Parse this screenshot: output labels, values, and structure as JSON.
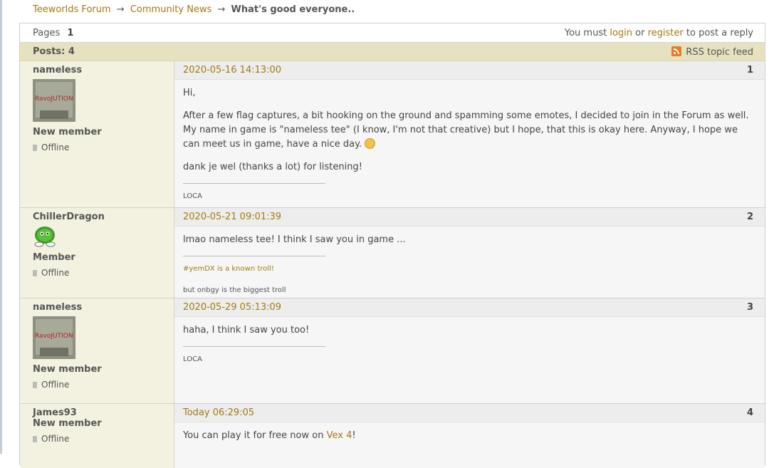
{
  "breadcrumb": {
    "forum": "Teeworlds Forum",
    "section": "Community News",
    "topic": "What's good everyone..",
    "separator": "→"
  },
  "pagination": {
    "label": "Pages",
    "current": "1"
  },
  "login_prompt": {
    "prefix": "You must",
    "login": "login",
    "or": "or",
    "register": "register",
    "suffix": "to post a reply"
  },
  "posts_bar": {
    "count_label": "Posts: 4",
    "rss_label": "RSS topic feed"
  },
  "colors": {
    "link": "#a07a10",
    "author_bg": "#f3f2e0",
    "posts_bar_bg": "#e6e2c0",
    "rss": "#e87b24"
  },
  "posts": [
    {
      "number": "1",
      "date": "2020-05-16 14:13:00",
      "author": "nameless",
      "avatar": "avatar-ravolution",
      "avatar_text": "RavoJUTION",
      "rank": "New member",
      "status": "Offline",
      "paragraphs": [
        "Hi,",
        "After a few flag captures, a bit hooking on the ground and spamming some emotes, I decided to join in the Forum as well. My name in game is \"nameless tee\" (I know, I'm not that creative) but I hope, that this is okay here. Anyway, I hope we can meet us in game, have a nice day.",
        "dank je wel (thanks a lot) for listening!"
      ],
      "signature": [
        "LOCA"
      ]
    },
    {
      "number": "2",
      "date": "2020-05-21 09:01:39",
      "author": "ChillerDragon",
      "avatar": "avatar-green-tee",
      "rank": "Member",
      "status": "Offline",
      "paragraphs": [
        "lmao nameless tee! I think I saw you in game ..."
      ],
      "signature": [
        "#yemDX is a known troll!",
        "but onbgy is the biggest troll"
      ]
    },
    {
      "number": "3",
      "date": "2020-05-29 05:13:09",
      "author": "nameless",
      "avatar": "avatar-ravolution",
      "avatar_text": "RavoJUTION",
      "rank": "New member",
      "status": "Offline",
      "paragraphs": [
        "haha, I think I saw you too!"
      ],
      "signature": [
        "LOCA"
      ]
    },
    {
      "number": "4",
      "date": "Today 06:29:05",
      "author": "James93",
      "rank": "New member",
      "status": "Offline",
      "text_prefix": "You can play it for free now on",
      "link": "Vex 4",
      "text_suffix": "!"
    }
  ]
}
